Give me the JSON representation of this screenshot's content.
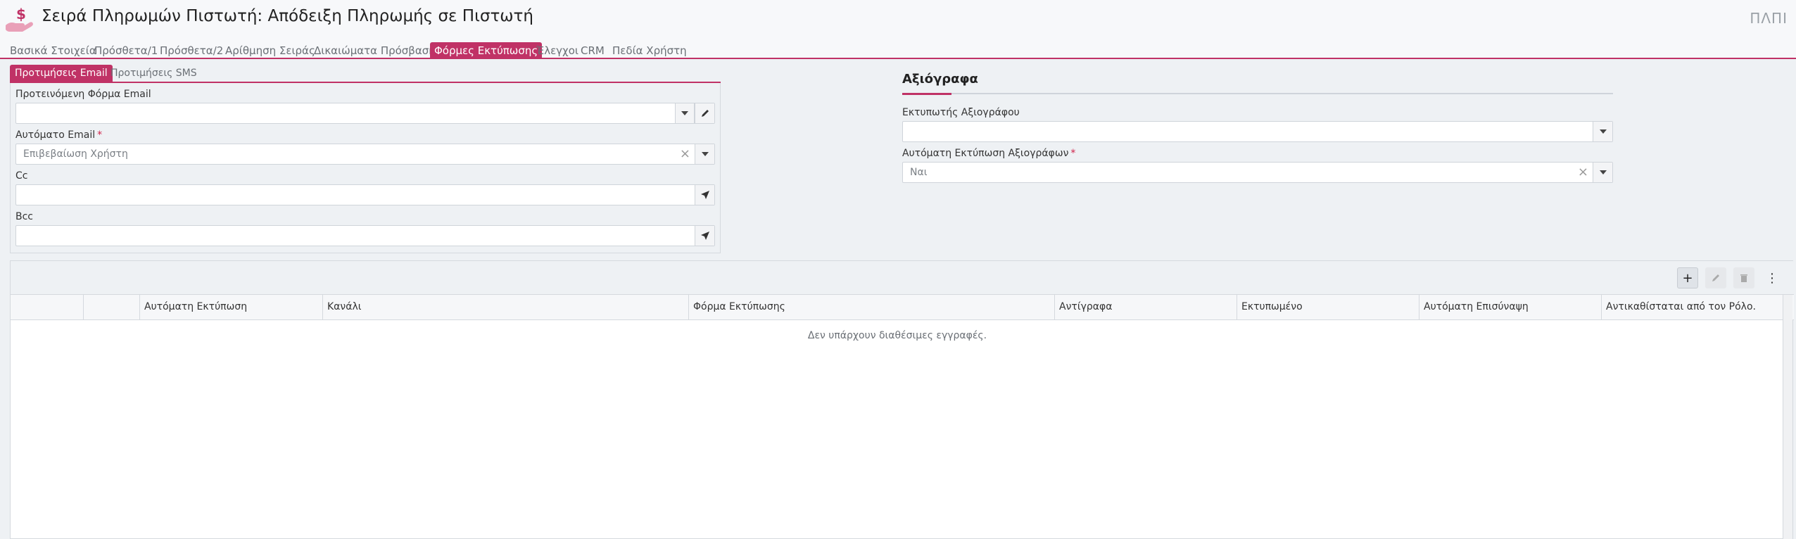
{
  "header": {
    "title": "Σειρά Πληρωμών Πιστωτή: Απόδειξη Πληρωμής σε Πιστωτή",
    "right_label": "ΠΛΠΙ",
    "icon": "payment-hand-icon"
  },
  "tabs": [
    {
      "label": "Βασικά Στοιχεία",
      "active": false
    },
    {
      "label": "Πρόσθετα/1",
      "active": false
    },
    {
      "label": "Πρόσθετα/2",
      "active": false
    },
    {
      "label": "Αρίθμηση Σειράς",
      "active": false
    },
    {
      "label": "Δικαιώματα Πρόσβασης",
      "active": false
    },
    {
      "label": "Φόρμες Εκτύπωσης",
      "active": true
    },
    {
      "label": "Έλεγχοι",
      "active": false
    },
    {
      "label": "CRM",
      "active": false
    },
    {
      "label": "Πεδία Χρήστη",
      "active": false
    }
  ],
  "email": {
    "subtabs": [
      {
        "label": "Προτιμήσεις Email",
        "active": true
      },
      {
        "label": "Προτιμήσεις SMS",
        "active": false
      }
    ],
    "default_form_label": "Προτεινόμενη Φόρμα Email",
    "default_form_value": "",
    "auto_email_label": "Αυτόματο Email",
    "auto_email_value": "Επιβεβαίωση Χρήστη",
    "cc_label": "Cc",
    "cc_value": "",
    "bcc_label": "Bcc",
    "bcc_value": ""
  },
  "documents": {
    "title": "Αξιόγραφα",
    "printer_label": "Εκτυπωτής Αξιογράφου",
    "printer_value": "",
    "auto_print_label": "Αυτόματη Εκτύπωση Αξιογράφων",
    "auto_print_value": "Ναι"
  },
  "grid": {
    "columns": [
      "",
      "",
      "Αυτόματη Εκτύπωση",
      "Κανάλι",
      "Φόρμα Εκτύπωσης",
      "Αντίγραφα",
      "Εκτυπωμένο",
      "Αυτόματη Επισύναψη",
      "Αντικαθίσταται από τον Ρόλο."
    ],
    "empty_message": "Δεν υπάρχουν διαθέσιμες εγγραφές.",
    "toolbar": {
      "add": "+",
      "more": "⋮"
    }
  },
  "colors": {
    "accent": "#c03266"
  }
}
